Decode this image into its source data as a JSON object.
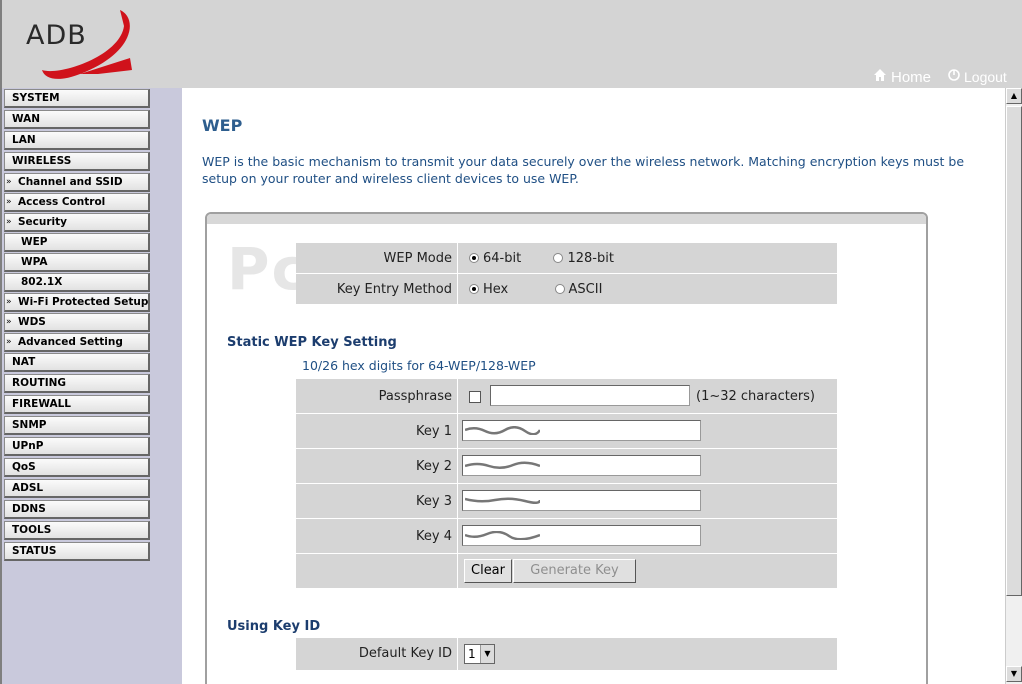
{
  "header": {
    "logo_text": "ADB",
    "home_label": "Home",
    "logout_label": "Logout"
  },
  "sidebar": {
    "items": [
      {
        "label": "SYSTEM"
      },
      {
        "label": "WAN"
      },
      {
        "label": "LAN"
      },
      {
        "label": "WIRELESS"
      },
      {
        "label": "Channel and SSID"
      },
      {
        "label": "Access Control"
      },
      {
        "label": "Security"
      },
      {
        "label": "WEP"
      },
      {
        "label": "WPA"
      },
      {
        "label": "802.1X"
      },
      {
        "label": "Wi-Fi Protected Setup"
      },
      {
        "label": "WDS"
      },
      {
        "label": "Advanced Setting"
      },
      {
        "label": "NAT"
      },
      {
        "label": "ROUTING"
      },
      {
        "label": "FIREWALL"
      },
      {
        "label": "SNMP"
      },
      {
        "label": "UPnP"
      },
      {
        "label": "QoS"
      },
      {
        "label": "ADSL"
      },
      {
        "label": "DDNS"
      },
      {
        "label": "TOOLS"
      },
      {
        "label": "STATUS"
      }
    ]
  },
  "main": {
    "title": "WEP",
    "intro": "WEP is the basic mechanism to transmit your data securely over the wireless network. Matching encryption keys must be setup on your router and wireless client devices to use WEP.",
    "watermark": "PcWintech.com",
    "wep_mode": {
      "label": "WEP Mode",
      "options": [
        "64-bit",
        "128-bit"
      ],
      "selected": "64-bit"
    },
    "key_entry": {
      "label": "Key Entry Method",
      "options": [
        "Hex",
        "ASCII"
      ],
      "selected": "Hex"
    },
    "static_section": {
      "title": "Static WEP Key Setting",
      "hint": "10/26 hex digits for 64-WEP/128-WEP",
      "passphrase_label": "Passphrase",
      "passphrase_value": "",
      "passphrase_note": "(1~32 characters)",
      "keys": [
        {
          "label": "Key 1"
        },
        {
          "label": "Key 2"
        },
        {
          "label": "Key 3"
        },
        {
          "label": "Key 4"
        }
      ],
      "clear_button": "Clear",
      "generate_button": "Generate Key"
    },
    "key_id_section": {
      "title": "Using Key ID",
      "default_label": "Default Key ID",
      "default_value": "1"
    }
  }
}
